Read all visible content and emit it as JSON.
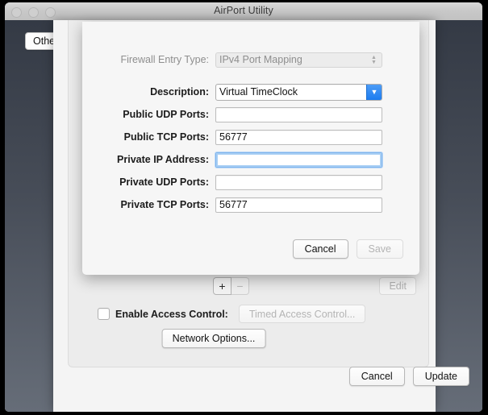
{
  "window": {
    "title": "AirPort Utility",
    "traffic_lights": [
      "close-button",
      "minimize-button",
      "zoom-button"
    ]
  },
  "background": {
    "other_button": "Other"
  },
  "sheet": {
    "fields": [
      {
        "label": "Firewall Entry Type:",
        "value": "IPv4 Port Mapping",
        "type": "popup",
        "disabled": true,
        "name": "firewall-entry-type"
      },
      {
        "label": "Description:",
        "value": "Virtual TimeClock",
        "type": "combo",
        "disabled": false,
        "name": "description"
      },
      {
        "label": "Public UDP Ports:",
        "value": "",
        "type": "text",
        "disabled": false,
        "name": "public-udp-ports"
      },
      {
        "label": "Public TCP Ports:",
        "value": "56777",
        "type": "text",
        "disabled": false,
        "name": "public-tcp-ports"
      },
      {
        "label": "Private IP Address:",
        "value": "",
        "type": "text",
        "disabled": false,
        "focused": true,
        "name": "private-ip-address"
      },
      {
        "label": "Private UDP Ports:",
        "value": "",
        "type": "text",
        "disabled": false,
        "name": "private-udp-ports"
      },
      {
        "label": "Private TCP Ports:",
        "value": "56777",
        "type": "text",
        "disabled": false,
        "name": "private-tcp-ports"
      }
    ],
    "cancel_label": "Cancel",
    "save_label": "Save"
  },
  "panel": {
    "add_label": "+",
    "remove_label": "−",
    "edit_label": "Edit",
    "access_control_label": "Enable Access Control:",
    "timed_access_label": "Timed Access Control...",
    "network_options_label": "Network Options..."
  },
  "footer": {
    "cancel_label": "Cancel",
    "update_label": "Update"
  },
  "colors": {
    "accent_blue": "#1b7cf0",
    "focus_ring": "#a9cff4",
    "desktop_dark": "#474d58"
  }
}
